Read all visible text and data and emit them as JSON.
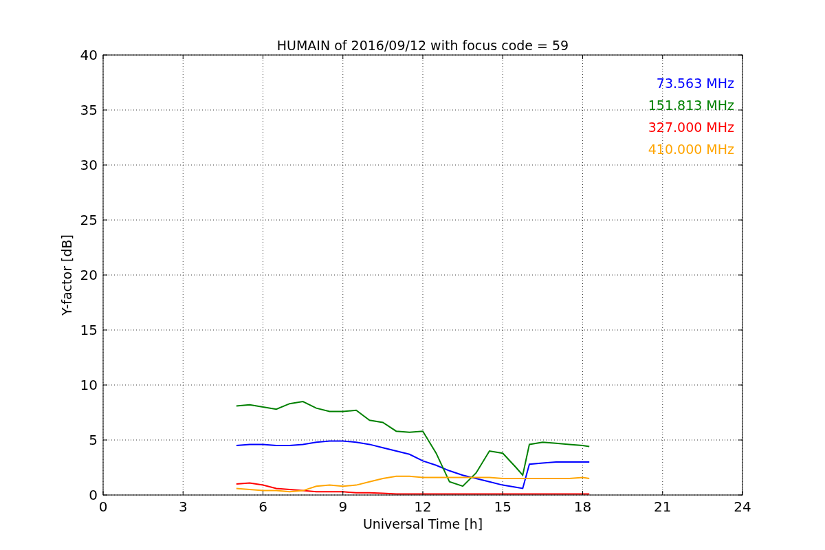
{
  "chart_data": {
    "type": "line",
    "title": "HUMAIN of 2016/09/12 with focus code = 59",
    "xlabel": "Universal Time [h]",
    "ylabel": "Y-factor [dB]",
    "x": [
      5,
      5.5,
      6,
      6.5,
      7,
      7.5,
      8,
      8.5,
      9,
      9.5,
      10,
      10.5,
      11,
      11.5,
      12,
      12.5,
      13,
      13.5,
      14,
      14.5,
      15,
      15.5,
      15.75,
      16,
      16.5,
      17,
      17.5,
      18,
      18.25
    ],
    "series": [
      {
        "name": "73.563 MHz",
        "color": "#0000ff",
        "values": [
          4.5,
          4.6,
          4.6,
          4.5,
          4.5,
          4.6,
          4.8,
          4.9,
          4.9,
          4.8,
          4.6,
          4.3,
          4.0,
          3.7,
          3.1,
          2.7,
          2.2,
          1.8,
          1.5,
          1.2,
          0.9,
          0.7,
          0.6,
          2.8,
          2.9,
          3.0,
          3.0,
          3.0,
          3.0
        ]
      },
      {
        "name": "151.813 MHz",
        "color": "#008000",
        "values": [
          8.1,
          8.2,
          8.0,
          7.8,
          8.3,
          8.5,
          7.9,
          7.6,
          7.6,
          7.7,
          6.8,
          6.6,
          5.8,
          5.7,
          5.8,
          3.8,
          1.2,
          0.8,
          2.0,
          4.0,
          3.8,
          2.5,
          1.8,
          4.6,
          4.8,
          4.7,
          4.6,
          4.5,
          4.4
        ]
      },
      {
        "name": "327.000 MHz",
        "color": "#ff0000",
        "values": [
          1.0,
          1.1,
          0.9,
          0.6,
          0.5,
          0.4,
          0.3,
          0.3,
          0.3,
          0.2,
          0.2,
          0.15,
          0.1,
          0.1,
          0.1,
          0.1,
          0.1,
          0.1,
          0.1,
          0.1,
          0.1,
          0.1,
          0.1,
          0.1,
          0.1,
          0.1,
          0.1,
          0.1,
          0.1
        ]
      },
      {
        "name": "410.000 MHz",
        "color": "#ffa500",
        "values": [
          0.6,
          0.5,
          0.4,
          0.4,
          0.3,
          0.4,
          0.8,
          0.9,
          0.8,
          0.9,
          1.2,
          1.5,
          1.7,
          1.7,
          1.6,
          1.6,
          1.6,
          1.6,
          1.6,
          1.6,
          1.5,
          1.5,
          1.5,
          1.5,
          1.5,
          1.5,
          1.5,
          1.6,
          1.5
        ]
      }
    ],
    "xlim": [
      0,
      24
    ],
    "ylim": [
      0,
      40
    ],
    "xticks": [
      0,
      3,
      6,
      9,
      12,
      15,
      18,
      21,
      24
    ],
    "yticks": [
      0,
      5,
      10,
      15,
      20,
      25,
      30,
      35,
      40
    ],
    "grid": true
  }
}
